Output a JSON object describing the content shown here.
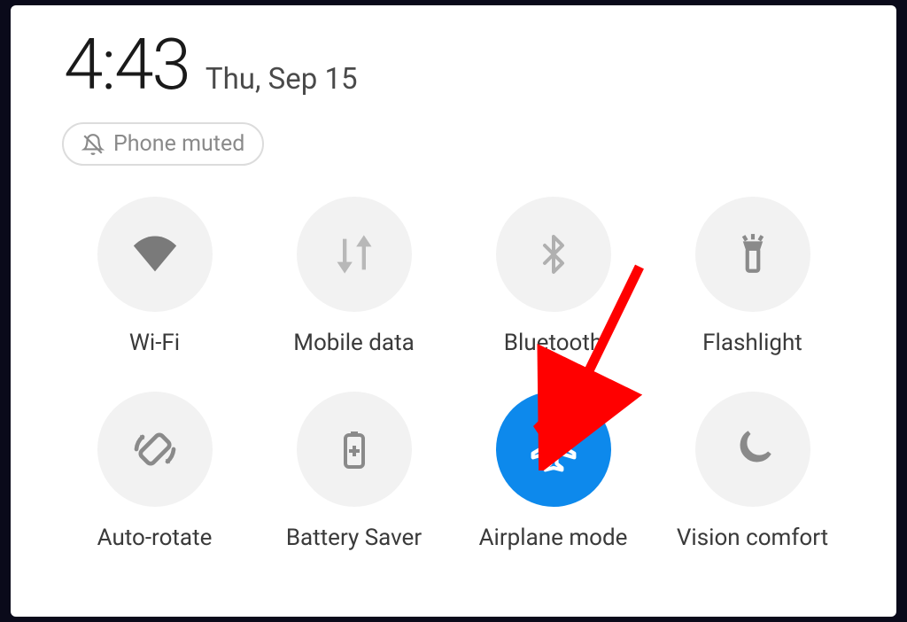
{
  "header": {
    "time": "4:43",
    "date": "Thu, Sep 15"
  },
  "muted": {
    "label": "Phone muted"
  },
  "tiles": {
    "wifi": {
      "label": "Wi-Fi",
      "active": false
    },
    "mobile_data": {
      "label": "Mobile data",
      "active": false
    },
    "bluetooth": {
      "label": "Bluetooth",
      "active": false
    },
    "flashlight": {
      "label": "Flashlight",
      "active": false
    },
    "auto_rotate": {
      "label": "Auto-rotate",
      "active": false
    },
    "battery_saver": {
      "label": "Battery Saver",
      "active": false
    },
    "airplane_mode": {
      "label": "Airplane mode",
      "active": true
    },
    "vision_comfort": {
      "label": "Vision comfort",
      "active": false
    }
  },
  "colors": {
    "tile_inactive": "#f2f2f2",
    "tile_active": "#0d89ec",
    "icon_inactive": "#8a8a8a",
    "icon_active": "#ffffff",
    "annotation": "#ff0000"
  }
}
